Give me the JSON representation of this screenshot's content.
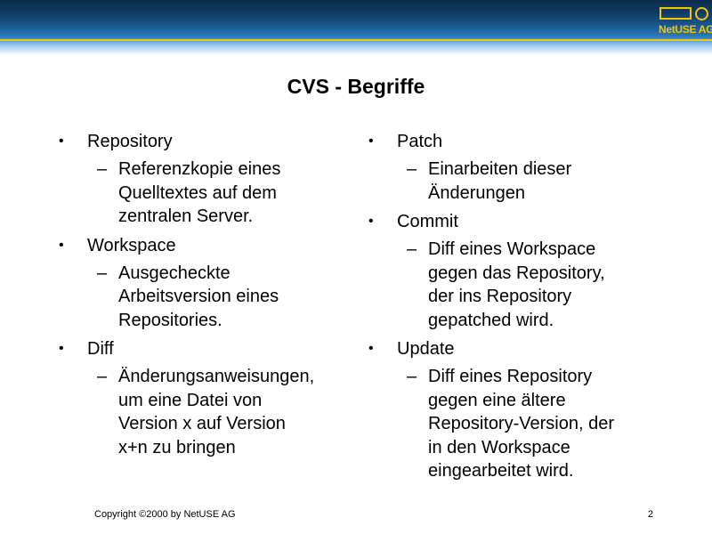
{
  "header": {
    "logo_text": "NetUSE AG",
    "colors": {
      "bar": "#103a61",
      "accent": "#f5c400"
    }
  },
  "title": "CVS - Begriffe",
  "left_column": [
    {
      "term": "Repository",
      "lines": [
        "Referenzkopie eines",
        "Quelltextes auf dem",
        "zentralen Server."
      ]
    },
    {
      "term": "Workspace",
      "lines": [
        "Ausgecheckte",
        "Arbeitsversion eines",
        "Repositories."
      ]
    },
    {
      "term": "Diff",
      "lines": [
        "Änderungsanweisungen,",
        "um eine Datei von",
        "Version x auf Version",
        "x+n zu bringen"
      ]
    }
  ],
  "right_column": [
    {
      "term": "Patch",
      "lines": [
        "Einarbeiten dieser",
        "Änderungen"
      ]
    },
    {
      "term": "Commit",
      "lines": [
        "Diff eines Workspace",
        "gegen das Repository,",
        "der ins Repository",
        "gepatched wird."
      ]
    },
    {
      "term": "Update",
      "lines": [
        "Diff eines Repository",
        "gegen eine ältere",
        "Repository-Version, der",
        "in den Workspace",
        "eingearbeitet wird."
      ]
    }
  ],
  "footer": {
    "copyright": "Copyright ©2000 by NetUSE AG",
    "page_number": "2"
  }
}
